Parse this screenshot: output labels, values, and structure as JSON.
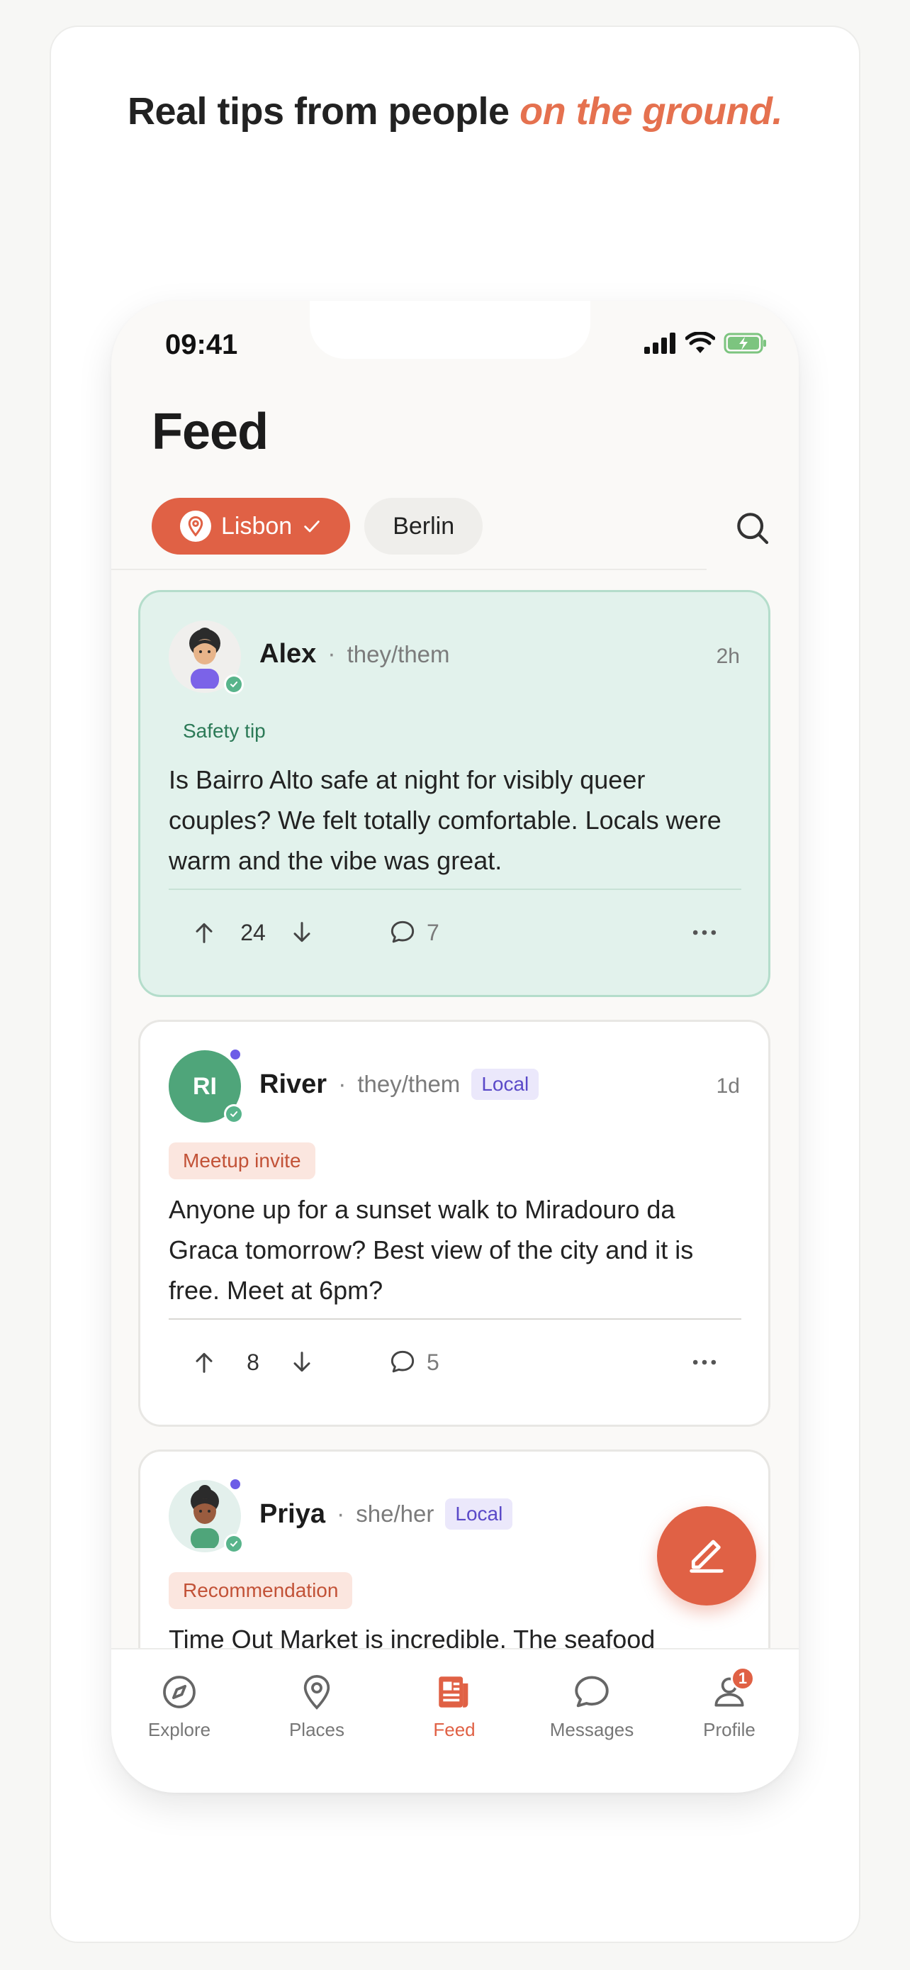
{
  "headline": {
    "main": "Real tips from people ",
    "accent": "on the ground."
  },
  "status_bar": {
    "time": "09:41"
  },
  "page": {
    "title": "Feed"
  },
  "city_chips": [
    {
      "label": "Lisbon",
      "selected": true
    },
    {
      "label": "Berlin",
      "selected": false
    }
  ],
  "posts": [
    {
      "author": "Alex",
      "pronouns": "they/them",
      "time": "2h",
      "local": false,
      "tag": "Safety tip",
      "body": "Is Bairro Alto safe at night for visibly queer couples? We felt totally comfortable. Locals were warm and the vibe was great.",
      "votes": "24",
      "comments": "7"
    },
    {
      "author": "River",
      "initials": "RI",
      "pronouns": "they/them",
      "local_label": "Local",
      "time": "1d",
      "tag": "Meetup invite",
      "body": "Anyone up for a sunset walk to Miradouro da Graca tomorrow? Best view of the city and it is free. Meet at 6pm?",
      "votes": "8",
      "comments": "5"
    },
    {
      "author": "Priya",
      "pronouns": "she/her",
      "local_label": "Local",
      "tag": "Recommendation",
      "body": "Time Out Market is incredible. The seafood"
    }
  ],
  "tab_bar": [
    {
      "label": "Explore",
      "icon": "compass-icon"
    },
    {
      "label": "Places",
      "icon": "map-pin-icon"
    },
    {
      "label": "Feed",
      "icon": "newspaper-icon",
      "active": true
    },
    {
      "label": "Messages",
      "icon": "chat-bubble-icon"
    },
    {
      "label": "Profile",
      "icon": "user-icon",
      "badge": "1"
    }
  ],
  "colors": {
    "accent": "#e06145",
    "highlight_bg": "#e2f2ec",
    "local_badge": "#5a49c8"
  }
}
